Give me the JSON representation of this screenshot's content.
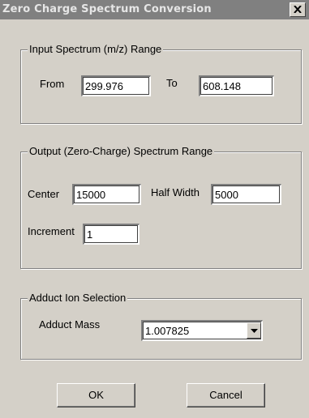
{
  "window": {
    "title": "Zero Charge Spectrum Conversion",
    "close_glyph": "×"
  },
  "input_range": {
    "legend": "Input Spectrum (m/z) Range",
    "from_label": "From",
    "from_value": "299.976",
    "to_label": "To",
    "to_value": "608.148"
  },
  "output_range": {
    "legend": "Output (Zero-Charge) Spectrum Range",
    "center_label": "Center",
    "center_value": "15000",
    "half_width_label": "Half Width",
    "half_width_value": "5000",
    "increment_label": "Increment",
    "increment_value": "1"
  },
  "adduct": {
    "legend": "Adduct Ion Selection",
    "mass_label": "Adduct Mass",
    "mass_value": "1.007825"
  },
  "buttons": {
    "ok": "OK",
    "cancel": "Cancel"
  }
}
